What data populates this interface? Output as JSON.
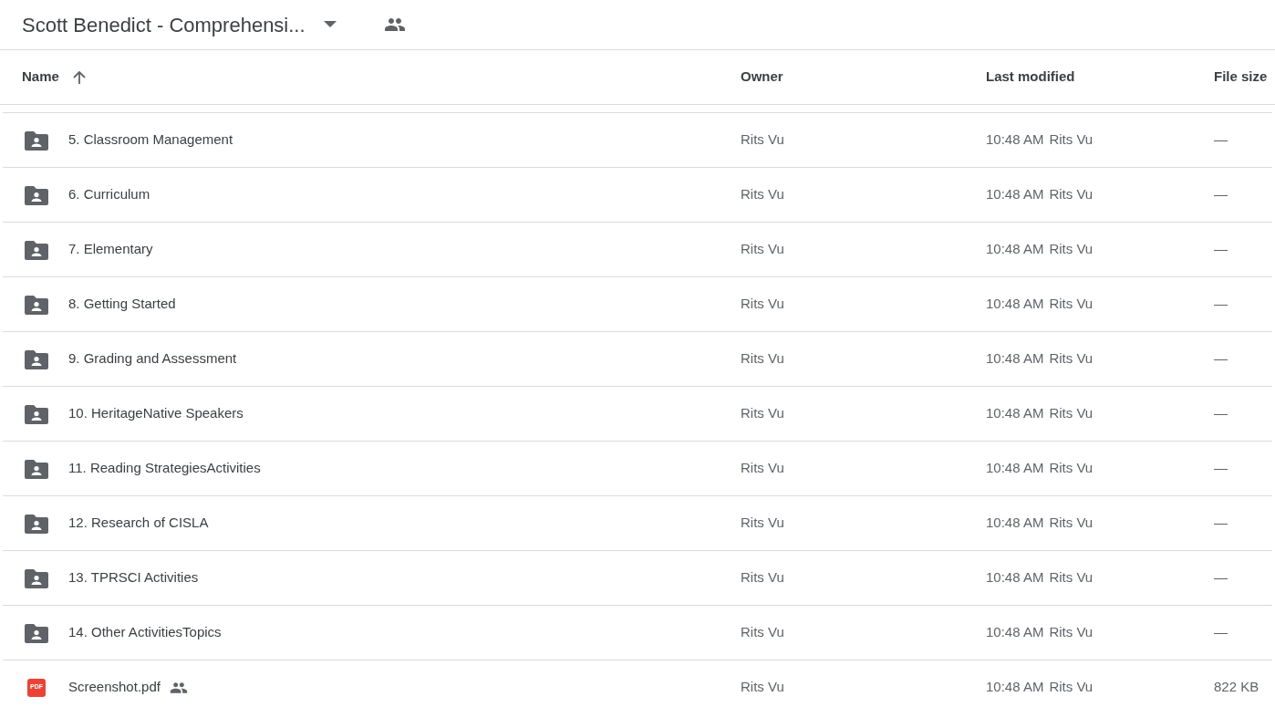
{
  "header": {
    "title": "Scott Benedict - Comprehensi...",
    "shared": true
  },
  "table": {
    "columns": [
      {
        "label": "Name",
        "sorted": true
      },
      {
        "label": "Owner",
        "sorted": false
      },
      {
        "label": "Last modified",
        "sorted": false
      },
      {
        "label": "File size",
        "sorted": false
      }
    ],
    "rows": [
      {
        "kind": "folder",
        "name": "5. Classroom Management",
        "shared": false,
        "owner": "Rits Vu",
        "modified_time": "10:48 AM",
        "modified_by": "Rits Vu",
        "size": "—"
      },
      {
        "kind": "folder",
        "name": "6. Curriculum",
        "shared": false,
        "owner": "Rits Vu",
        "modified_time": "10:48 AM",
        "modified_by": "Rits Vu",
        "size": "—"
      },
      {
        "kind": "folder",
        "name": "7. Elementary",
        "shared": false,
        "owner": "Rits Vu",
        "modified_time": "10:48 AM",
        "modified_by": "Rits Vu",
        "size": "—"
      },
      {
        "kind": "folder",
        "name": "8. Getting Started",
        "shared": false,
        "owner": "Rits Vu",
        "modified_time": "10:48 AM",
        "modified_by": "Rits Vu",
        "size": "—"
      },
      {
        "kind": "folder",
        "name": "9. Grading and Assessment",
        "shared": false,
        "owner": "Rits Vu",
        "modified_time": "10:48 AM",
        "modified_by": "Rits Vu",
        "size": "—"
      },
      {
        "kind": "folder",
        "name": "10. HeritageNative Speakers",
        "shared": false,
        "owner": "Rits Vu",
        "modified_time": "10:48 AM",
        "modified_by": "Rits Vu",
        "size": "—"
      },
      {
        "kind": "folder",
        "name": "11. Reading StrategiesActivities",
        "shared": false,
        "owner": "Rits Vu",
        "modified_time": "10:48 AM",
        "modified_by": "Rits Vu",
        "size": "—"
      },
      {
        "kind": "folder",
        "name": "12. Research of CISLA",
        "shared": false,
        "owner": "Rits Vu",
        "modified_time": "10:48 AM",
        "modified_by": "Rits Vu",
        "size": "—"
      },
      {
        "kind": "folder",
        "name": "13. TPRSCI Activities",
        "shared": false,
        "owner": "Rits Vu",
        "modified_time": "10:48 AM",
        "modified_by": "Rits Vu",
        "size": "—"
      },
      {
        "kind": "folder",
        "name": "14. Other ActivitiesTopics",
        "shared": false,
        "owner": "Rits Vu",
        "modified_time": "10:48 AM",
        "modified_by": "Rits Vu",
        "size": "—"
      },
      {
        "kind": "pdf",
        "icon_label": "PDF",
        "name": "Screenshot.pdf",
        "shared": true,
        "owner": "Rits Vu",
        "modified_time": "10:48 AM",
        "modified_by": "Rits Vu",
        "size": "822 KB"
      }
    ]
  }
}
